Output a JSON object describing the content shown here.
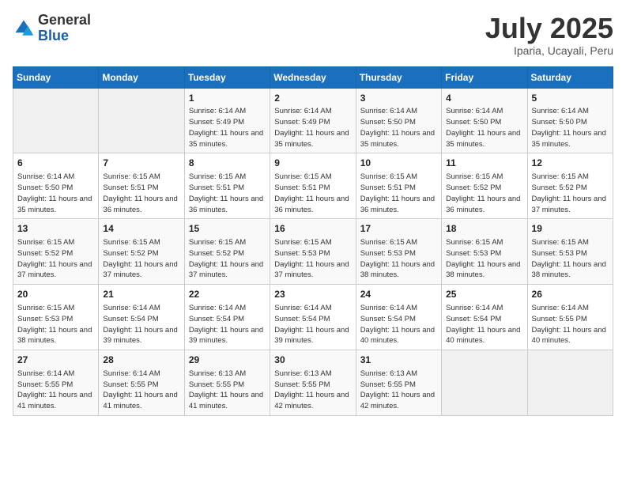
{
  "logo": {
    "general": "General",
    "blue": "Blue"
  },
  "title": "July 2025",
  "location": "Iparia, Ucayali, Peru",
  "days_of_week": [
    "Sunday",
    "Monday",
    "Tuesday",
    "Wednesday",
    "Thursday",
    "Friday",
    "Saturday"
  ],
  "weeks": [
    [
      {
        "day": "",
        "content": ""
      },
      {
        "day": "",
        "content": ""
      },
      {
        "day": "1",
        "content": "Sunrise: 6:14 AM\nSunset: 5:49 PM\nDaylight: 11 hours and 35 minutes."
      },
      {
        "day": "2",
        "content": "Sunrise: 6:14 AM\nSunset: 5:49 PM\nDaylight: 11 hours and 35 minutes."
      },
      {
        "day": "3",
        "content": "Sunrise: 6:14 AM\nSunset: 5:50 PM\nDaylight: 11 hours and 35 minutes."
      },
      {
        "day": "4",
        "content": "Sunrise: 6:14 AM\nSunset: 5:50 PM\nDaylight: 11 hours and 35 minutes."
      },
      {
        "day": "5",
        "content": "Sunrise: 6:14 AM\nSunset: 5:50 PM\nDaylight: 11 hours and 35 minutes."
      }
    ],
    [
      {
        "day": "6",
        "content": "Sunrise: 6:14 AM\nSunset: 5:50 PM\nDaylight: 11 hours and 35 minutes."
      },
      {
        "day": "7",
        "content": "Sunrise: 6:15 AM\nSunset: 5:51 PM\nDaylight: 11 hours and 36 minutes."
      },
      {
        "day": "8",
        "content": "Sunrise: 6:15 AM\nSunset: 5:51 PM\nDaylight: 11 hours and 36 minutes."
      },
      {
        "day": "9",
        "content": "Sunrise: 6:15 AM\nSunset: 5:51 PM\nDaylight: 11 hours and 36 minutes."
      },
      {
        "day": "10",
        "content": "Sunrise: 6:15 AM\nSunset: 5:51 PM\nDaylight: 11 hours and 36 minutes."
      },
      {
        "day": "11",
        "content": "Sunrise: 6:15 AM\nSunset: 5:52 PM\nDaylight: 11 hours and 36 minutes."
      },
      {
        "day": "12",
        "content": "Sunrise: 6:15 AM\nSunset: 5:52 PM\nDaylight: 11 hours and 37 minutes."
      }
    ],
    [
      {
        "day": "13",
        "content": "Sunrise: 6:15 AM\nSunset: 5:52 PM\nDaylight: 11 hours and 37 minutes."
      },
      {
        "day": "14",
        "content": "Sunrise: 6:15 AM\nSunset: 5:52 PM\nDaylight: 11 hours and 37 minutes."
      },
      {
        "day": "15",
        "content": "Sunrise: 6:15 AM\nSunset: 5:52 PM\nDaylight: 11 hours and 37 minutes."
      },
      {
        "day": "16",
        "content": "Sunrise: 6:15 AM\nSunset: 5:53 PM\nDaylight: 11 hours and 37 minutes."
      },
      {
        "day": "17",
        "content": "Sunrise: 6:15 AM\nSunset: 5:53 PM\nDaylight: 11 hours and 38 minutes."
      },
      {
        "day": "18",
        "content": "Sunrise: 6:15 AM\nSunset: 5:53 PM\nDaylight: 11 hours and 38 minutes."
      },
      {
        "day": "19",
        "content": "Sunrise: 6:15 AM\nSunset: 5:53 PM\nDaylight: 11 hours and 38 minutes."
      }
    ],
    [
      {
        "day": "20",
        "content": "Sunrise: 6:15 AM\nSunset: 5:53 PM\nDaylight: 11 hours and 38 minutes."
      },
      {
        "day": "21",
        "content": "Sunrise: 6:14 AM\nSunset: 5:54 PM\nDaylight: 11 hours and 39 minutes."
      },
      {
        "day": "22",
        "content": "Sunrise: 6:14 AM\nSunset: 5:54 PM\nDaylight: 11 hours and 39 minutes."
      },
      {
        "day": "23",
        "content": "Sunrise: 6:14 AM\nSunset: 5:54 PM\nDaylight: 11 hours and 39 minutes."
      },
      {
        "day": "24",
        "content": "Sunrise: 6:14 AM\nSunset: 5:54 PM\nDaylight: 11 hours and 40 minutes."
      },
      {
        "day": "25",
        "content": "Sunrise: 6:14 AM\nSunset: 5:54 PM\nDaylight: 11 hours and 40 minutes."
      },
      {
        "day": "26",
        "content": "Sunrise: 6:14 AM\nSunset: 5:55 PM\nDaylight: 11 hours and 40 minutes."
      }
    ],
    [
      {
        "day": "27",
        "content": "Sunrise: 6:14 AM\nSunset: 5:55 PM\nDaylight: 11 hours and 41 minutes."
      },
      {
        "day": "28",
        "content": "Sunrise: 6:14 AM\nSunset: 5:55 PM\nDaylight: 11 hours and 41 minutes."
      },
      {
        "day": "29",
        "content": "Sunrise: 6:13 AM\nSunset: 5:55 PM\nDaylight: 11 hours and 41 minutes."
      },
      {
        "day": "30",
        "content": "Sunrise: 6:13 AM\nSunset: 5:55 PM\nDaylight: 11 hours and 42 minutes."
      },
      {
        "day": "31",
        "content": "Sunrise: 6:13 AM\nSunset: 5:55 PM\nDaylight: 11 hours and 42 minutes."
      },
      {
        "day": "",
        "content": ""
      },
      {
        "day": "",
        "content": ""
      }
    ]
  ]
}
